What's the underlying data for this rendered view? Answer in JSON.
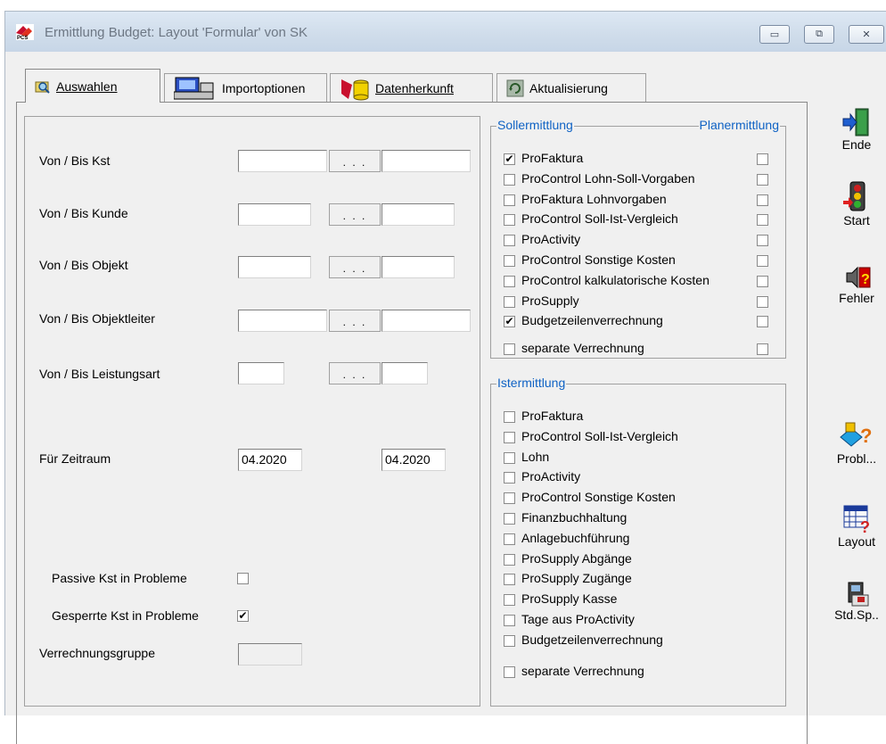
{
  "window": {
    "title": "Ermittlung Budget: Layout 'Formular' von SK",
    "controls": {
      "minimize": "▭",
      "restore": "⧉",
      "close": "✕"
    }
  },
  "tabs": [
    {
      "label": "Auswahlen",
      "active": true,
      "icon": "search-folder-icon"
    },
    {
      "label": "Importoptionen",
      "active": false,
      "icon": "computer-import-icon"
    },
    {
      "label": "Datenherkunft",
      "active": false,
      "icon": "database-source-icon"
    },
    {
      "label": "Aktualisierung",
      "active": false,
      "icon": "refresh-icon"
    }
  ],
  "form": {
    "kst": {
      "label": "Von / Bis Kst",
      "from": "",
      "to": "",
      "dots": ". . ."
    },
    "kunde": {
      "label": "Von / Bis Kunde",
      "from": "",
      "to": "",
      "dots": ". . ."
    },
    "objekt": {
      "label": "Von / Bis Objekt",
      "from": "",
      "to": "",
      "dots": ". . ."
    },
    "objektleiter": {
      "label": "Von / Bis Objektleiter",
      "from": "",
      "to": "",
      "dots": ". . ."
    },
    "leistungsart": {
      "label": "Von / Bis Leistungsart",
      "from": "",
      "to": "",
      "dots": ". . ."
    },
    "zeitraum": {
      "label": "Für Zeitraum",
      "from": "04.2020",
      "to": "04.2020"
    },
    "passive": {
      "label": "Passive Kst in Probleme",
      "checked": false
    },
    "gesperrte": {
      "label": "Gesperrte Kst in Probleme",
      "checked": true
    },
    "verrechnungsgruppe": {
      "label": "Verrechnungsgruppe",
      "value": ""
    }
  },
  "soll": {
    "legend_left": "Sollermittlung",
    "legend_right": "Planermittlung",
    "items": [
      {
        "label": "ProFaktura",
        "checked": true,
        "plan": false
      },
      {
        "label": "ProControl Lohn-Soll-Vorgaben",
        "checked": false,
        "plan": false
      },
      {
        "label": "ProFaktura Lohnvorgaben",
        "checked": false,
        "plan": false
      },
      {
        "label": "ProControl Soll-Ist-Vergleich",
        "checked": false,
        "plan": false
      },
      {
        "label": "ProActivity",
        "checked": false,
        "plan": false
      },
      {
        "label": "ProControl Sonstige Kosten",
        "checked": false,
        "plan": false
      },
      {
        "label": "ProControl kalkulatorische Kosten",
        "checked": false,
        "plan": false
      },
      {
        "label": "ProSupply",
        "checked": false,
        "plan": false
      },
      {
        "label": "Budgetzeilenverrechnung",
        "checked": true,
        "plan": false
      },
      {
        "label": "separate Verrechnung",
        "checked": false,
        "plan": false
      }
    ]
  },
  "ist": {
    "legend": "Istermittlung",
    "items": [
      {
        "label": "ProFaktura",
        "checked": false
      },
      {
        "label": "ProControl Soll-Ist-Vergleich",
        "checked": false
      },
      {
        "label": "Lohn",
        "checked": false
      },
      {
        "label": "ProActivity",
        "checked": false
      },
      {
        "label": "ProControl Sonstige Kosten",
        "checked": false
      },
      {
        "label": "Finanzbuchhaltung",
        "checked": false
      },
      {
        "label": "Anlagebuchführung",
        "checked": false
      },
      {
        "label": "ProSupply Abgänge",
        "checked": false
      },
      {
        "label": "ProSupply Zugänge",
        "checked": false
      },
      {
        "label": "ProSupply Kasse",
        "checked": false
      },
      {
        "label": "Tage aus ProActivity",
        "checked": false
      },
      {
        "label": "Budgetzeilenverrechnung",
        "checked": false
      },
      {
        "label": "separate Verrechnung",
        "checked": false
      }
    ]
  },
  "sidebar": [
    {
      "label": "Ende",
      "icon": "exit-door-icon"
    },
    {
      "label": "Start",
      "icon": "traffic-light-icon"
    },
    {
      "label": "Fehler",
      "icon": "error-speaker-icon"
    },
    {
      "label": "Probl...",
      "icon": "problems-icon"
    },
    {
      "label": "Layout",
      "icon": "layout-icon"
    },
    {
      "label": "Std.Sp..",
      "icon": "save-default-icon"
    }
  ],
  "check_mark": "✔"
}
